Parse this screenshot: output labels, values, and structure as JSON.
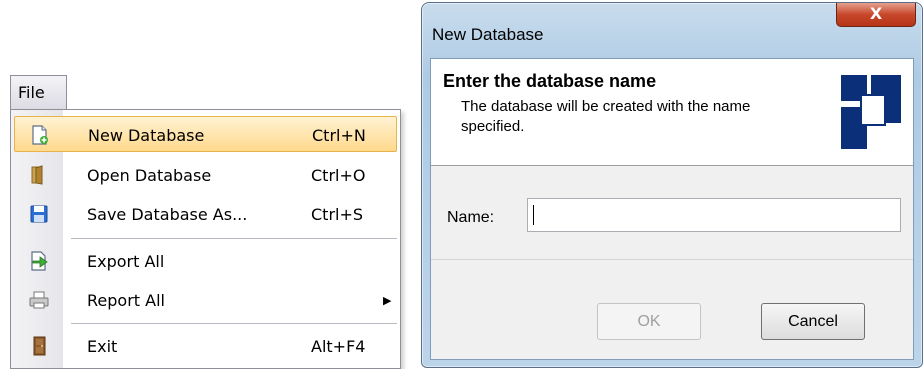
{
  "menu": {
    "title": "File",
    "items": [
      {
        "label": "New Database",
        "accel": "Ctrl+N",
        "icon": "new-database-icon"
      },
      {
        "label": "Open Database",
        "accel": "Ctrl+O",
        "icon": "open-folder-icon"
      },
      {
        "label": "Save Database As...",
        "accel": "Ctrl+S",
        "icon": "save-disk-icon"
      },
      {
        "label": "Export All",
        "accel": "",
        "icon": "export-arrow-icon"
      },
      {
        "label": "Report All",
        "accel": "",
        "icon": "printer-icon"
      },
      {
        "label": "Exit",
        "accel": "Alt+F4",
        "icon": "exit-door-icon"
      }
    ]
  },
  "dialog": {
    "title": "New Database",
    "close_label": "X",
    "heading": "Enter the database name",
    "description": "The database will be created with the name specified.",
    "name_label": "Name:",
    "name_value": "",
    "ok_label": "OK",
    "cancel_label": "Cancel"
  },
  "colors": {
    "highlight": "#ffd98c",
    "title_bar": "#aecbe4",
    "close_button": "#c8472a",
    "logo_blue": "#0b2f78"
  }
}
